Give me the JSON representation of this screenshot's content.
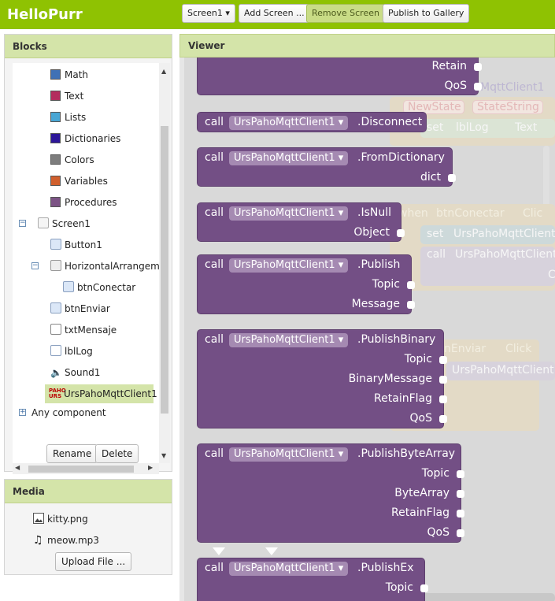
{
  "app": {
    "title": "HelloPurr"
  },
  "toolbar": {
    "screen_dropdown": "Screen1 ▾",
    "add_screen": "Add Screen ...",
    "remove_screen": "Remove Screen",
    "publish": "Publish to Gallery"
  },
  "blocks_panel": {
    "header": "Blocks",
    "builtin": [
      {
        "label": "Math",
        "color": "#3f71b5"
      },
      {
        "label": "Text",
        "color": "#b32d5e"
      },
      {
        "label": "Lists",
        "color": "#49a6d4"
      },
      {
        "label": "Dictionaries",
        "color": "#2d1799"
      },
      {
        "label": "Colors",
        "color": "#7d7d7d"
      },
      {
        "label": "Variables",
        "color": "#d05f2d"
      },
      {
        "label": "Procedures",
        "color": "#7c5385"
      }
    ],
    "screen": "Screen1",
    "components": {
      "button1": "Button1",
      "harr": "HorizontalArrangemer",
      "btn_conectar": "btnConectar",
      "btn_enviar": "btnEnviar",
      "txt_mensaje": "txtMensaje",
      "lbl_log": "lblLog",
      "sound1": "Sound1",
      "mqtt": "UrsPahoMqttClient1"
    },
    "any_component": "Any component",
    "rename": "Rename",
    "delete": "Delete"
  },
  "media_panel": {
    "header": "Media",
    "files": [
      "kitty.png",
      "meow.mp3"
    ],
    "upload": "Upload File ..."
  },
  "viewer": {
    "header": "Viewer",
    "background_blocks": {
      "mqtt_frag": "MqttClient1",
      "newstate": "NewState",
      "statestring": "StateString",
      "set": "set",
      "lbllog": "lblLog",
      "text": "Text",
      "when": "when",
      "btnconectar": "btnConectar",
      "click": "Clic",
      "set_urs": "UrsPahoMqttClient",
      "call": "call",
      "call_urs": "UrsPahoMqttClient1",
      "c": "C",
      "nenviar": "nEnviar",
      "click2": "Click",
      "urs2": "UrsPahoMqttClient1"
    },
    "blocks": [
      {
        "ports": [
          "Retain",
          "QoS"
        ]
      },
      {
        "call": "call",
        "component": "UrsPahoMqttClient1",
        "method": ".Disconnect",
        "ports": []
      },
      {
        "call": "call",
        "component": "UrsPahoMqttClient1",
        "method": ".FromDictionary",
        "ports": [
          "dict"
        ]
      },
      {
        "call": "call",
        "component": "UrsPahoMqttClient1",
        "method": ".IsNull",
        "ports": [
          "Object"
        ]
      },
      {
        "call": "call",
        "component": "UrsPahoMqttClient1",
        "method": ".Publish",
        "ports": [
          "Topic",
          "Message"
        ]
      },
      {
        "call": "call",
        "component": "UrsPahoMqttClient1",
        "method": ".PublishBinary",
        "ports": [
          "Topic",
          "BinaryMessage",
          "RetainFlag",
          "QoS"
        ]
      },
      {
        "call": "call",
        "component": "UrsPahoMqttClient1",
        "method": ".PublishByteArray",
        "ports": [
          "Topic",
          "ByteArray",
          "RetainFlag",
          "QoS"
        ]
      },
      {
        "call": "call",
        "component": "UrsPahoMqttClient1",
        "method": ".PublishEx",
        "ports": [
          "Topic"
        ]
      }
    ]
  }
}
